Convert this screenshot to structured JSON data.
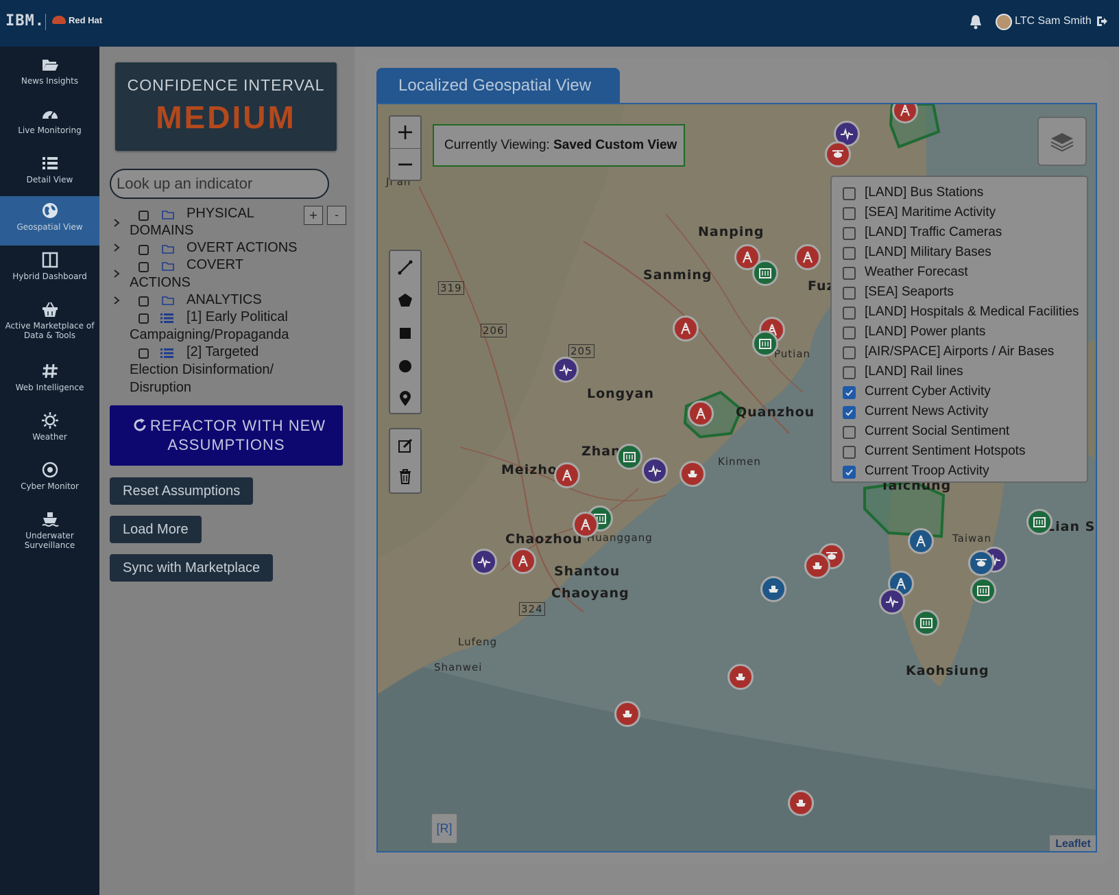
{
  "header": {
    "brand_ibm": "IBM.",
    "brand_redhat": "Red Hat",
    "user_name": "LTC Sam Smith"
  },
  "sidebar": {
    "items": [
      {
        "label": "News Insights",
        "icon": "folder-open-icon"
      },
      {
        "label": "Live Monitoring",
        "icon": "gauge-icon"
      },
      {
        "label": "Detail View",
        "icon": "list-icon"
      },
      {
        "label": "Geospatial View",
        "icon": "globe-icon",
        "active": true
      },
      {
        "label": "Hybrid Dashboard",
        "icon": "columns-icon"
      },
      {
        "label": "Active Marketplace of Data & Tools",
        "icon": "basket-icon"
      },
      {
        "label": "Web Intelligence",
        "icon": "hashtag-icon"
      },
      {
        "label": "Weather",
        "icon": "sun-icon"
      },
      {
        "label": "Cyber Monitor",
        "icon": "target-icon"
      },
      {
        "label": "Underwater Surveillance",
        "icon": "ship-icon"
      }
    ]
  },
  "confidence": {
    "label": "CONFIDENCE INTERVAL",
    "value": "MEDIUM"
  },
  "search": {
    "placeholder": "Look up an indicator"
  },
  "tree": {
    "expand_label": "+",
    "collapse_label": "-",
    "items": [
      {
        "line1": "PHYSICAL",
        "line2": "DOMAINS",
        "type": "folder"
      },
      {
        "line1": "OVERT ACTIONS",
        "type": "folder"
      },
      {
        "line1": "COVERT",
        "line2": "ACTIONS",
        "type": "folder"
      },
      {
        "line1": "ANALYTICS",
        "type": "folder"
      },
      {
        "line1": "[1] Early Political",
        "line2": "Campaigning/Propaganda",
        "type": "list"
      },
      {
        "line1": "[2] Targeted",
        "line2": "Election Disinformation/",
        "line3": "Disruption",
        "type": "list"
      }
    ]
  },
  "actions": {
    "refactor_line1": "REFACTOR WITH NEW",
    "refactor_line2": "ASSUMPTIONS",
    "reset": "Reset Assumptions",
    "load_more": "Load More",
    "sync": "Sync with Marketplace"
  },
  "map": {
    "tab_title": "Localized Geospatial View",
    "viewing_prefix": "Currently Viewing:",
    "viewing_value": "Saved Custom View",
    "zoom_in": "+",
    "zoom_out": "−",
    "attribution": "Leaflet",
    "r_tag": "[R]",
    "layers": [
      {
        "label": "[LAND] Bus Stations",
        "checked": false
      },
      {
        "label": "[SEA] Maritime Activity",
        "checked": false
      },
      {
        "label": "[LAND] Traffic Cameras",
        "checked": false
      },
      {
        "label": "[LAND] Military Bases",
        "checked": false
      },
      {
        "label": "Weather Forecast",
        "checked": false
      },
      {
        "label": "[SEA] Seaports",
        "checked": false
      },
      {
        "label": "[LAND] Hospitals & Medical Facilities",
        "checked": false
      },
      {
        "label": "[LAND] Power plants",
        "checked": false
      },
      {
        "label": "[AIR/SPACE] Airports / Air Bases",
        "checked": false
      },
      {
        "label": "[LAND] Rail lines",
        "checked": false
      },
      {
        "label": "Current Cyber Activity",
        "checked": true
      },
      {
        "label": "Current News Activity",
        "checked": true
      },
      {
        "label": "Current Social Sentiment",
        "checked": false
      },
      {
        "label": "Current Sentiment Hotspots",
        "checked": false
      },
      {
        "label": "Current Troop Activity",
        "checked": true
      }
    ],
    "places": {
      "nanping": "Nanping",
      "sanming": "Sanming",
      "longyan": "Longyan",
      "quanzhou": "Quanzhou",
      "zhang": "Zhang",
      "kinmen": "Kinmen",
      "meizhou": "Meizhou",
      "chaozhou": "Chaozhou",
      "huanggang": "Huanggang",
      "shantou": "Shantou",
      "chaoyang": "Chaoyang",
      "lufeng": "Lufeng",
      "shanwei": "Shanwei",
      "taichung": "Taichung",
      "kaohsiung": "Kaohsiung",
      "taiwan": "Taiwan",
      "lian": "Lian S",
      "jian": "Ji'an",
      "putian": "Putian",
      "fuz": "Fuz",
      "route_319": "319",
      "route_206": "206",
      "route_205": "205",
      "route_324": "324"
    }
  }
}
